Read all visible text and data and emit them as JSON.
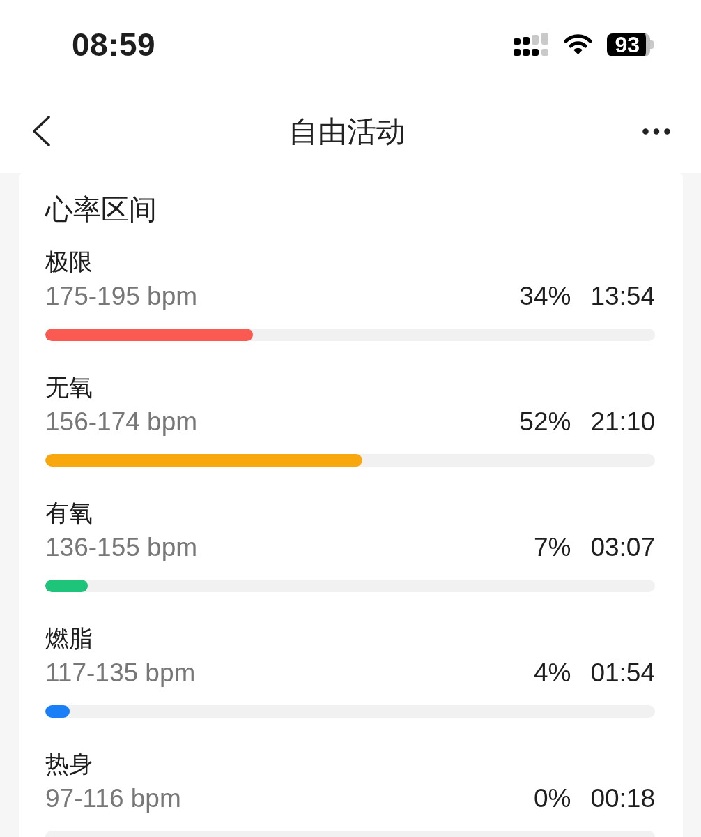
{
  "status_bar": {
    "time": "08:59",
    "battery": "93"
  },
  "nav_bar": {
    "title": "自由活动"
  },
  "card": {
    "title": "心率区间",
    "zones": [
      {
        "name": "极限",
        "range": "175-195 bpm",
        "percent": "34%",
        "duration": "13:54",
        "level": 0.34,
        "color": "#fa5a52"
      },
      {
        "name": "无氧",
        "range": "156-174 bpm",
        "percent": "52%",
        "duration": "21:10",
        "level": 0.52,
        "color": "#f8a80c"
      },
      {
        "name": "有氧",
        "range": "136-155 bpm",
        "percent": "7%",
        "duration": "03:07",
        "level": 0.07,
        "color": "#1ec47a"
      },
      {
        "name": "燃脂",
        "range": "117-135 bpm",
        "percent": "4%",
        "duration": "01:54",
        "level": 0.04,
        "color": "#1a7ef6"
      },
      {
        "name": "热身",
        "range": "97-116 bpm",
        "percent": "0%",
        "duration": "00:18"
      }
    ]
  }
}
